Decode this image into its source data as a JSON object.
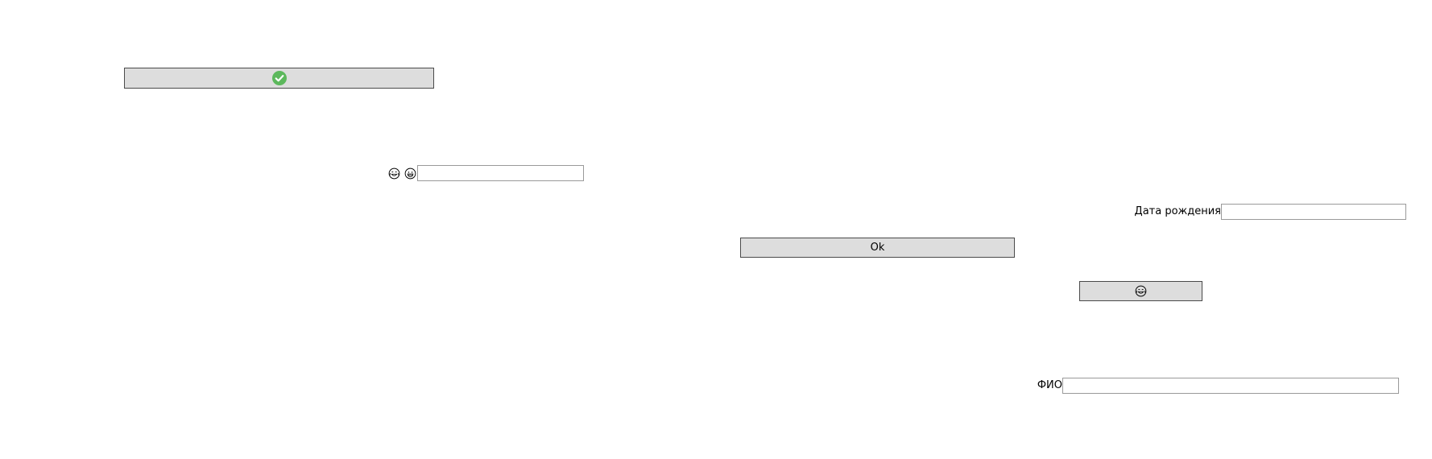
{
  "form": {
    "ok_button_label": "Ok",
    "birth_date_label": "Дата рождения",
    "birth_date_value": "",
    "full_name_label": "ФИО",
    "full_name_value": "",
    "emoji_field_value": ""
  },
  "icons": {
    "top_button_icon": "check-circle-icon",
    "top_button_icon_color": "#5cb85c",
    "emoji_1": "laughing-tears-emoji-icon",
    "emoji_2": "grinning-emoji-icon",
    "emoji_button_icon": "laughing-tears-emoji-icon"
  }
}
